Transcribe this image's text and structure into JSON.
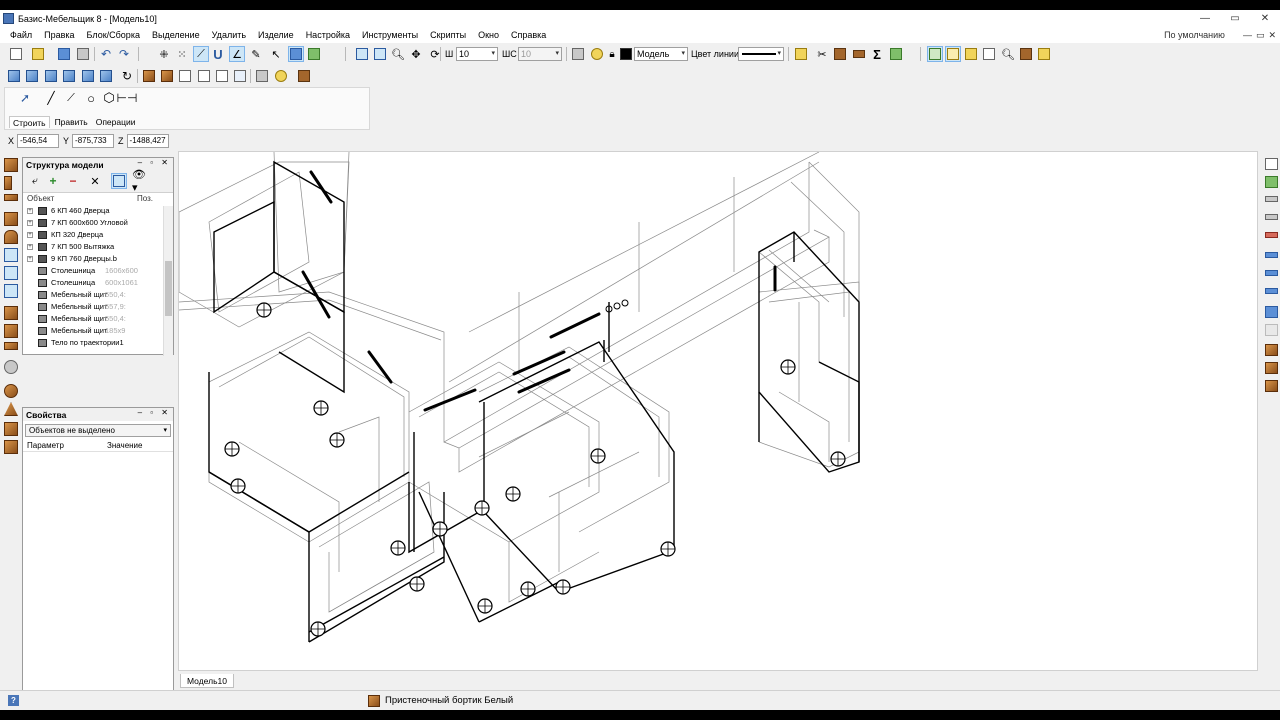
{
  "window": {
    "title": "Базис-Мебельщик 8 - [Модель10]",
    "controls": [
      "minimize-icon",
      "restore-icon",
      "close-icon"
    ],
    "inner_controls": [
      "—",
      "▭",
      "✕"
    ]
  },
  "menu": {
    "items": [
      "Файл",
      "Правка",
      "Блок/Сборка",
      "Выделение",
      "Удалить",
      "Изделие",
      "Настройка",
      "Инструменты",
      "Скрипты",
      "Окно",
      "Справка"
    ],
    "preset": "По умолчанию"
  },
  "toolbar": {
    "width_label": "Ш",
    "width_value": "10",
    "wc_label": "ШС",
    "wc_value": "10",
    "layer_value": "Модель",
    "line_color_label": "Цвет линии"
  },
  "palette": {
    "tabs": [
      "Строить",
      "Править",
      "Операции"
    ],
    "active_tab": "Строить"
  },
  "coords": {
    "x_label": "X",
    "x_value": "-546,54",
    "y_label": "Y",
    "y_value": "-875,733",
    "z_label": "Z",
    "z_value": "-1488,427"
  },
  "structure": {
    "title": "Структура модели",
    "col_object": "Объект",
    "col_pos": "Поз.",
    "rows": [
      {
        "label": "6 КП 460 Дверца",
        "dim": "",
        "expandable": true
      },
      {
        "label": "7 КП 600х600 Угловой",
        "dim": "",
        "expandable": true
      },
      {
        "label": "КП 320 Дверца",
        "dim": "",
        "expandable": true
      },
      {
        "label": "7 КП 500 Вытяжка",
        "dim": "",
        "expandable": true
      },
      {
        "label": "9 КП 760 Дверцы.b",
        "dim": "",
        "expandable": true
      },
      {
        "label": "Столешница",
        "dim": "1606x600",
        "expandable": false
      },
      {
        "label": "Столешница",
        "dim": "600x1061",
        "expandable": false
      },
      {
        "label": "Мебельный щит",
        "dim": "550,4:",
        "expandable": false
      },
      {
        "label": "Мебельный щит",
        "dim": "557,9:",
        "expandable": false
      },
      {
        "label": "Мебельный щит",
        "dim": "550,4:",
        "expandable": false
      },
      {
        "label": "Мебельный щит",
        "dim": "185x9",
        "expandable": false
      },
      {
        "label": "Тело по траектории1",
        "dim": "",
        "expandable": false
      }
    ]
  },
  "properties": {
    "title": "Свойства",
    "selection": "Объектов не выделено",
    "col_param": "Параметр",
    "col_value": "Значение"
  },
  "model_tab": "Модель10",
  "status": {
    "text": "Пристеночный бортик Белый"
  }
}
